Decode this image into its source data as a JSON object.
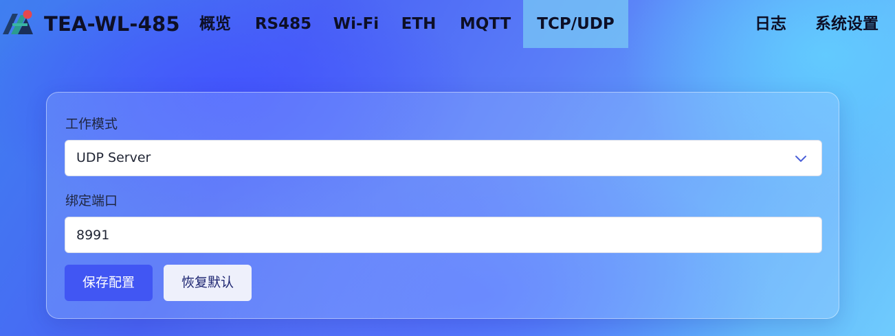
{
  "app": {
    "brand": "TEA-WL-485",
    "logo_icon": "app-logo-icon"
  },
  "nav": {
    "items": [
      {
        "id": "overview",
        "label": "概览",
        "active": false
      },
      {
        "id": "rs485",
        "label": "RS485",
        "active": false
      },
      {
        "id": "wifi",
        "label": "Wi-Fi",
        "active": false
      },
      {
        "id": "eth",
        "label": "ETH",
        "active": false
      },
      {
        "id": "mqtt",
        "label": "MQTT",
        "active": false
      },
      {
        "id": "tcpudp",
        "label": "TCP/UDP",
        "active": true
      }
    ],
    "right_items": [
      {
        "id": "log",
        "label": "日志"
      },
      {
        "id": "settings",
        "label": "系统设置"
      }
    ]
  },
  "form": {
    "mode": {
      "label": "工作模式",
      "value": "UDP Server",
      "icon": "chevron-down-icon"
    },
    "port": {
      "label": "绑定端口",
      "value": "8991"
    },
    "buttons": {
      "save": "保存配置",
      "reset": "恢复默认"
    }
  },
  "colors": {
    "primary": "#4156f3",
    "nav_active": "#78c8f5",
    "text_dark": "#0d0f26"
  }
}
